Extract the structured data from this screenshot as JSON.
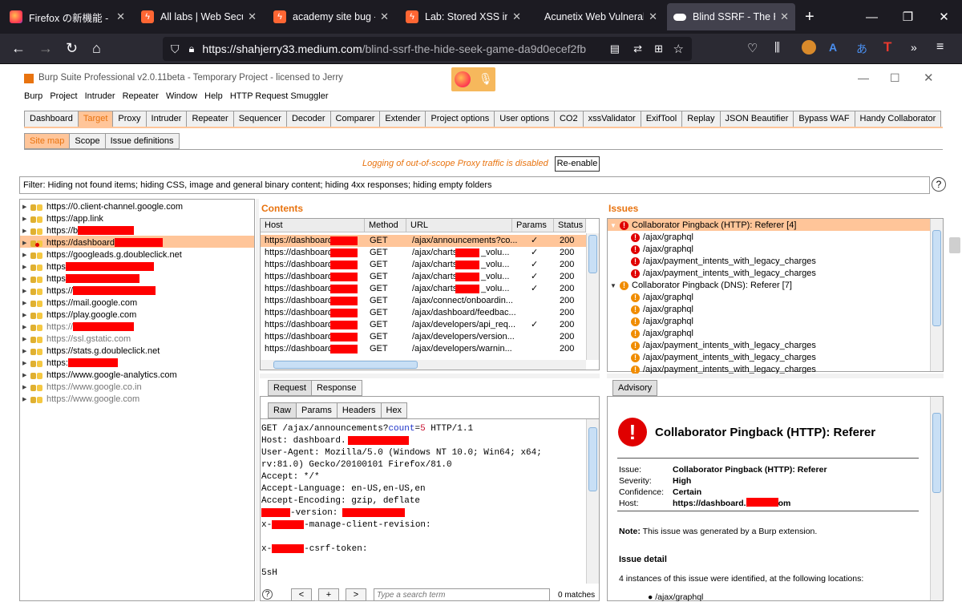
{
  "browser": {
    "tabs": [
      {
        "title": "Firefox の新機能 - プラ",
        "icon": "firefox-icon"
      },
      {
        "title": "All labs | Web Security",
        "icon": "portswigger-icon"
      },
      {
        "title": "academy site bug - Bu",
        "icon": "portswigger-icon"
      },
      {
        "title": "Lab: Stored XSS into H",
        "icon": "portswigger-icon"
      },
      {
        "title": "Acunetix Web Vulnerability",
        "icon": "none"
      },
      {
        "title": "Blind SSRF - The Hide",
        "icon": "medium-icon"
      }
    ],
    "url_host": "https://shahjerry33.medium.com",
    "url_path": "/blind-ssrf-the-hide-seek-game-da9d0ecef2fb",
    "new_tab": "+"
  },
  "burp": {
    "title": "Burp Suite Professional v2.0.11beta - Temporary Project - licensed to Jerry",
    "menu": [
      "Burp",
      "Project",
      "Intruder",
      "Repeater",
      "Window",
      "Help",
      "HTTP Request Smuggler"
    ],
    "main_tabs": [
      "Dashboard",
      "Target",
      "Proxy",
      "Intruder",
      "Repeater",
      "Sequencer",
      "Decoder",
      "Comparer",
      "Extender",
      "Project options",
      "User options",
      "CO2",
      "xssValidator",
      "ExifTool",
      "Replay",
      "JSON Beautifier",
      "Bypass WAF",
      "Handy Collaborator"
    ],
    "selected_main_tab": "Target",
    "sub_tabs": [
      "Site map",
      "Scope",
      "Issue definitions"
    ],
    "logging_notice": "Logging of out-of-scope Proxy traffic is disabled",
    "reenable": "Re-enable",
    "filter": "Filter: Hiding not found items;  hiding CSS, image and general binary content;  hiding 4xx responses;  hiding empty folders",
    "help": "?",
    "sitemap": [
      {
        "host": "https://0.client-channel.google.com",
        "gray": false,
        "redact": 0
      },
      {
        "host": "https://app.link",
        "gray": false,
        "redact": 0
      },
      {
        "host": "https://b",
        "gray": false,
        "redact": 70
      },
      {
        "host": "https://dashboard",
        "gray": false,
        "redact": 60
      },
      {
        "host": "https://googleads.g.doubleclick.net",
        "gray": false,
        "redact": 0
      },
      {
        "host": "https",
        "gray": false,
        "redact": 110
      },
      {
        "host": "https",
        "gray": false,
        "redact": 92
      },
      {
        "host": "https://",
        "gray": false,
        "redact": 103
      },
      {
        "host": "https://mail.google.com",
        "gray": false,
        "redact": 0
      },
      {
        "host": "https://play.google.com",
        "gray": false,
        "redact": 0
      },
      {
        "host": "https://",
        "gray": true,
        "redact": 76
      },
      {
        "host": "https://ssl.gstatic.com",
        "gray": true,
        "redact": 0
      },
      {
        "host": "https://stats.g.doubleclick.net",
        "gray": false,
        "redact": 0
      },
      {
        "host": "https:",
        "gray": false,
        "redact": 62
      },
      {
        "host": "https://www.google-analytics.com",
        "gray": false,
        "redact": 0
      },
      {
        "host": "https://www.google.co.in",
        "gray": true,
        "redact": 0
      },
      {
        "host": "https://www.google.com",
        "gray": true,
        "redact": 0
      }
    ],
    "selected_site_index": 3,
    "contents": {
      "title": "Contents",
      "headers": [
        "Host",
        "Method",
        "URL",
        "Params",
        "Status"
      ],
      "rows": [
        {
          "host": "https://dashboard",
          "method": "GET",
          "url": "/ajax/announcements?co...",
          "params": "✓",
          "status": "200"
        },
        {
          "host": "https://dashboard",
          "method": "GET",
          "url": "/ajax/charts",
          "url2": "_volu...",
          "params": "✓",
          "status": "200"
        },
        {
          "host": "https://dashboard",
          "method": "GET",
          "url": "/ajax/charts",
          "url2": "_volu...",
          "params": "✓",
          "status": "200"
        },
        {
          "host": "https://dashboard",
          "method": "GET",
          "url": "/ajax/charts",
          "url2": "_volu...",
          "params": "✓",
          "status": "200"
        },
        {
          "host": "https://dashboard",
          "method": "GET",
          "url": "/ajax/charts",
          "url2": "_volu...",
          "params": "✓",
          "status": "200"
        },
        {
          "host": "https://dashboard",
          "method": "GET",
          "url": "/ajax/connect/onboardin...",
          "params": "",
          "status": "200"
        },
        {
          "host": "https://dashboard",
          "method": "GET",
          "url": "/ajax/dashboard/feedbac...",
          "params": "",
          "status": "200"
        },
        {
          "host": "https://dashboard",
          "method": "GET",
          "url": "/ajax/developers/api_req...",
          "params": "✓",
          "status": "200"
        },
        {
          "host": "https://dashboard",
          "method": "GET",
          "url": "/ajax/developers/version...",
          "params": "",
          "status": "200"
        },
        {
          "host": "https://dashboard",
          "method": "GET",
          "url": "/ajax/developers/warnin...",
          "params": "",
          "status": "200"
        }
      ]
    },
    "issues": {
      "title": "Issues",
      "groups": [
        {
          "label": "Collaborator Pingback (HTTP): Referer [4]",
          "level": "high",
          "items": [
            "/ajax/graphql",
            "/ajax/graphql",
            "/ajax/payment_intents_with_legacy_charges",
            "/ajax/payment_intents_with_legacy_charges"
          ]
        },
        {
          "label": "Collaborator Pingback (DNS): Referer [7]",
          "level": "medium",
          "items": [
            "/ajax/graphql",
            "/ajax/graphql",
            "/ajax/graphql",
            "/ajax/graphql",
            "/ajax/payment_intents_with_legacy_charges",
            "/ajax/payment_intents_with_legacy_charges",
            "/ajax/payment_intents_with_legacy_charges"
          ]
        }
      ]
    },
    "request": {
      "tabs": [
        "Request",
        "Response"
      ],
      "view_tabs": [
        "Raw",
        "Params",
        "Headers",
        "Hex"
      ],
      "line1_a": "GET /ajax/announcements?",
      "line1_param": "count",
      "line1_eq": "=",
      "line1_val": "5",
      "line1_b": " HTTP/1.1",
      "lines": [
        "Host: dashboard.",
        "User-Agent: Mozilla/5.0 (Windows NT 10.0; Win64; x64;",
        "rv:81.0) Gecko/20100101 Firefox/81.0",
        "Accept: */*",
        "Accept-Language: en-US,en-US,en",
        "Accept-Encoding: gzip, deflate",
        "-version:",
        "x-",
        "-manage-client-revision:",
        "x-",
        "-csrf-token:",
        "5sH"
      ],
      "search_placeholder": "Type a search term",
      "matches": "0 matches",
      "nav_prev": "<",
      "nav_add": "+",
      "nav_next": ">",
      "help": "?"
    },
    "advisory": {
      "tab": "Advisory",
      "title": "Collaborator Pingback (HTTP): Referer",
      "issue_label": "Issue:",
      "issue_value": "Collaborator Pingback (HTTP): Referer",
      "severity_label": "Severity:",
      "severity_value": "High",
      "confidence_label": "Confidence:",
      "confidence_value": "Certain",
      "host_label": "Host:",
      "host_value": "https://dashboard.",
      "host_suffix": "om",
      "note_label": "Note:",
      "note_text": "This issue was generated by a Burp extension.",
      "detail_heading": "Issue detail",
      "detail_text": "4 instances of this issue were identified, at the following locations:",
      "first_location": "/ajax/graphql"
    }
  },
  "colors": {
    "accent": "#ff6633",
    "selected_row": "#ffc599",
    "issue_high": "#e00000",
    "issue_medium": "#f08c00",
    "redaction": "#ff0000"
  }
}
